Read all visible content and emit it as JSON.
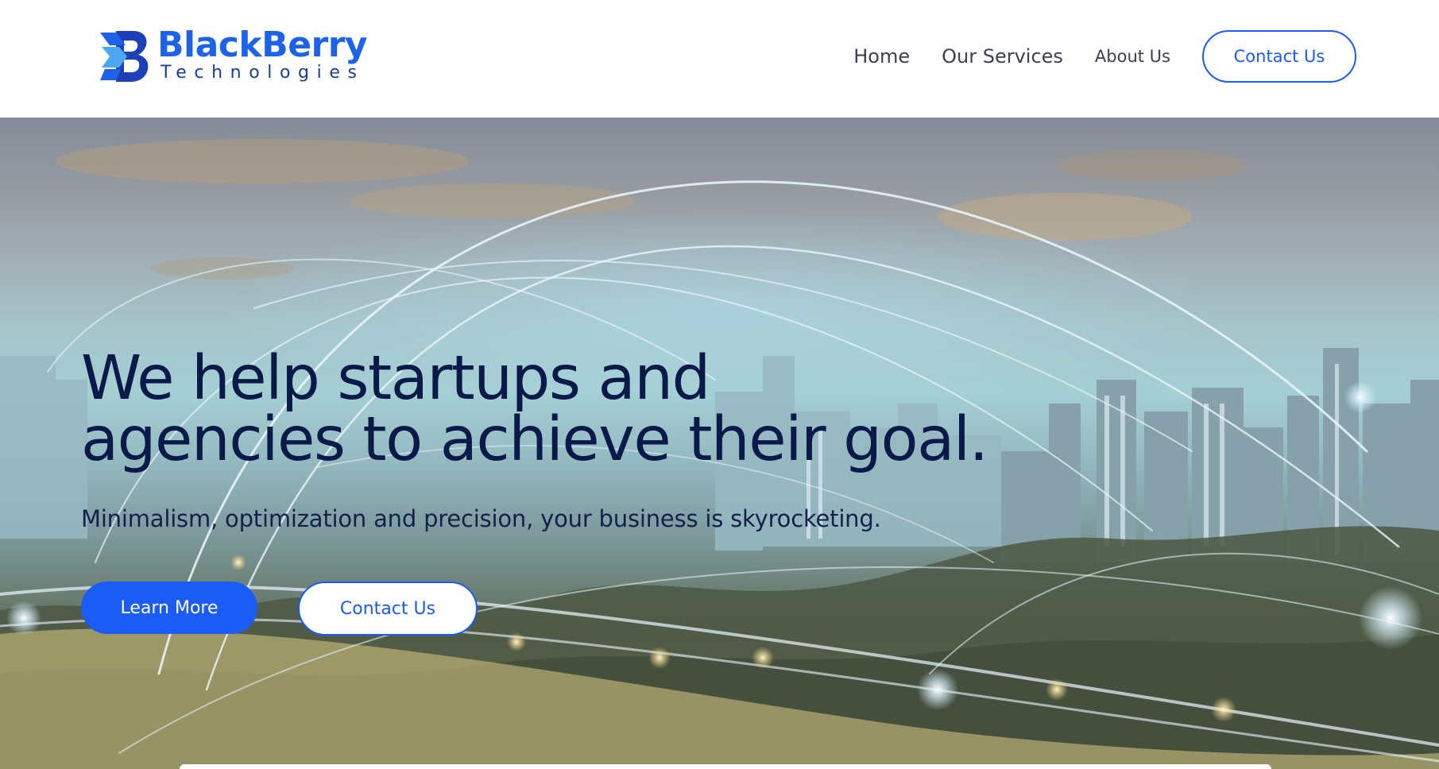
{
  "header": {
    "logo": {
      "name": "BlackBerry",
      "subtitle": "Technologies"
    },
    "nav": {
      "home": "Home",
      "services": "Our Services",
      "about": "About Us",
      "contact": "Contact Us"
    }
  },
  "hero": {
    "headline_line1": "We help startups and",
    "headline_line2": "agencies to achieve their goal.",
    "subtitle": "Minimalism, optimization and precision, your business is skyrocketing.",
    "primary_button": "Learn More",
    "secondary_button": "Contact Us",
    "background_image": "night city skyline with glowing network light arcs"
  },
  "colors": {
    "brand_blue": "#1d63ea",
    "button_blue": "#1a5cf5",
    "headline_navy": "#091a4a",
    "nav_text": "#3d3f52"
  },
  "icons": {
    "logo_mark": "blackberry-b-arrow-logo-icon"
  }
}
